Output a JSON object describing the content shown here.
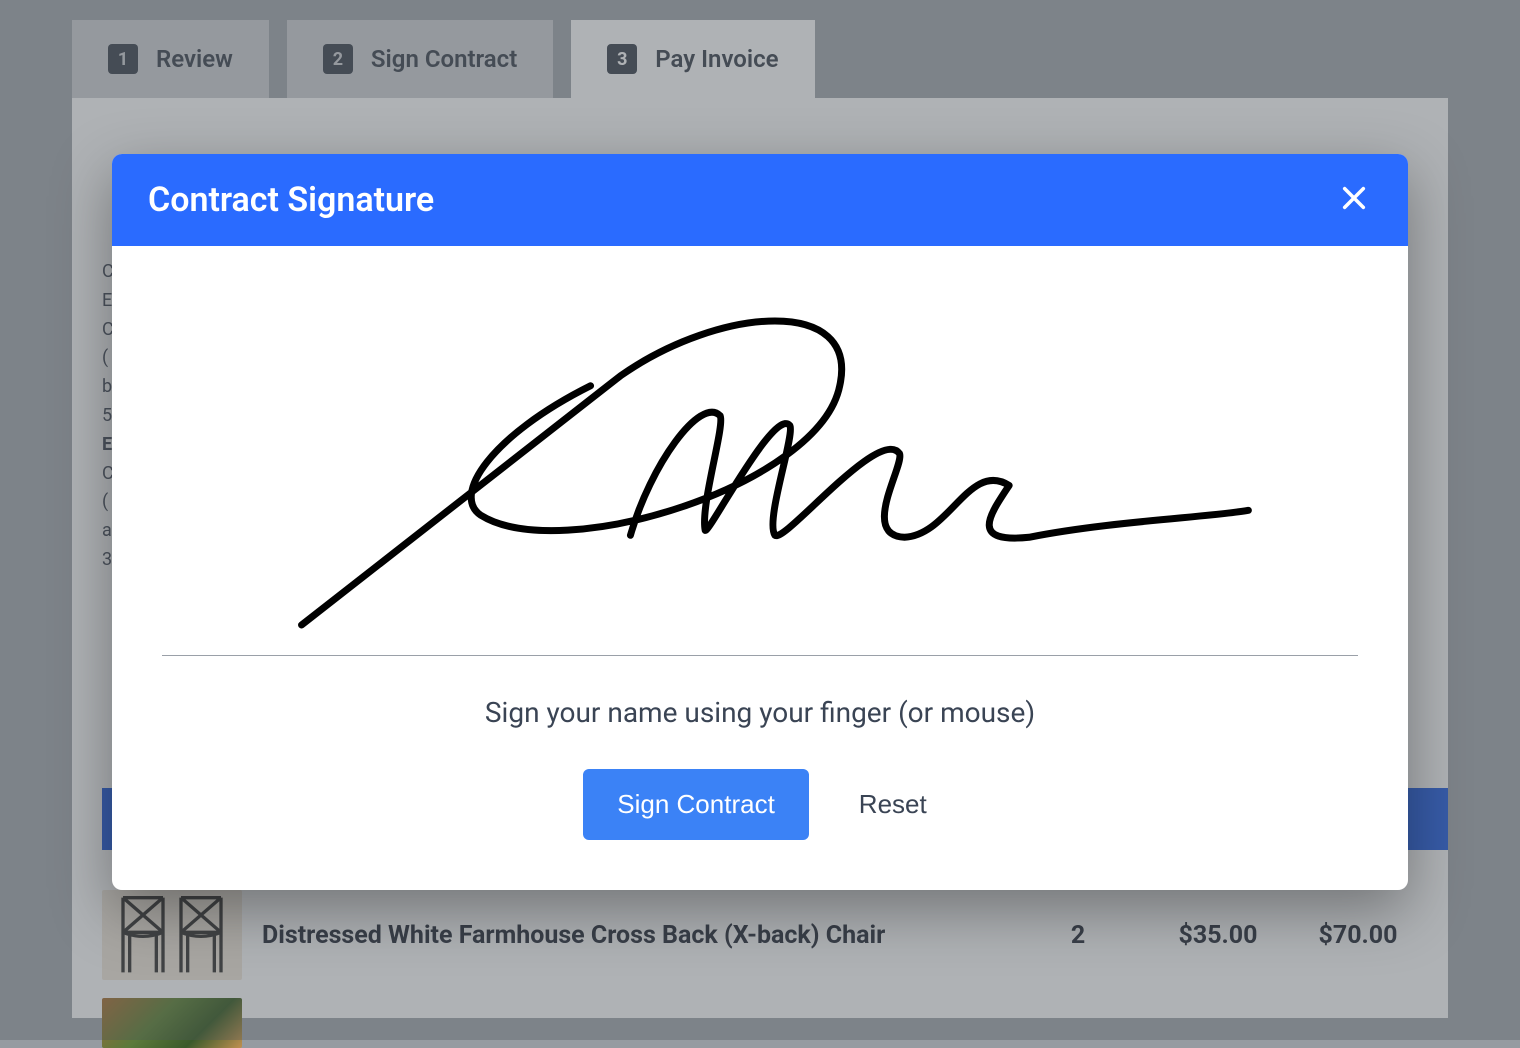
{
  "tabs": [
    {
      "num": "1",
      "label": "Review"
    },
    {
      "num": "2",
      "label": "Sign Contract"
    },
    {
      "num": "3",
      "label": "Pay Invoice"
    }
  ],
  "modal": {
    "title": "Contract Signature",
    "hint": "Sign your name using your finger (or mouse)",
    "sign_button": "Sign Contract",
    "reset_button": "Reset"
  },
  "item": {
    "name": "Distressed White Farmhouse Cross Back (X-back) Chair",
    "qty": "2",
    "price": "$35.00",
    "total": "$70.00"
  }
}
